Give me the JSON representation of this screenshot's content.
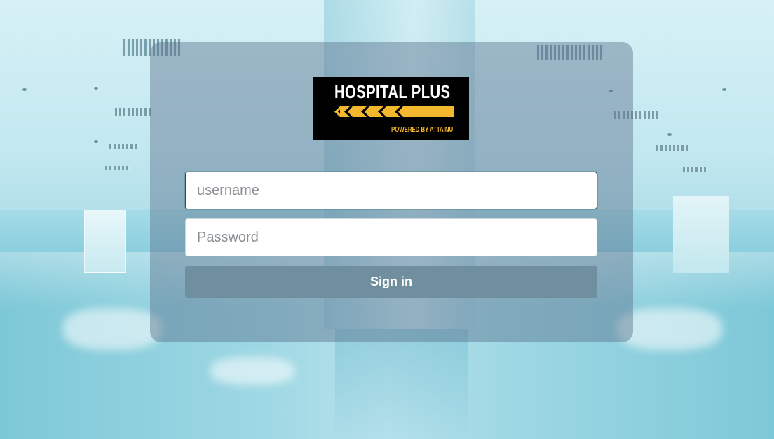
{
  "brand": {
    "title": "HOSPITAL PLUS",
    "subtitle": "POWERED BY ATTAINU",
    "accent_color": "#f4b82e",
    "logo_background": "#000000"
  },
  "login": {
    "username_placeholder": "username",
    "username_value": "",
    "password_placeholder": "Password",
    "password_value": "",
    "signin_label": "Sign in",
    "signin_color": "#6f8f9f"
  }
}
